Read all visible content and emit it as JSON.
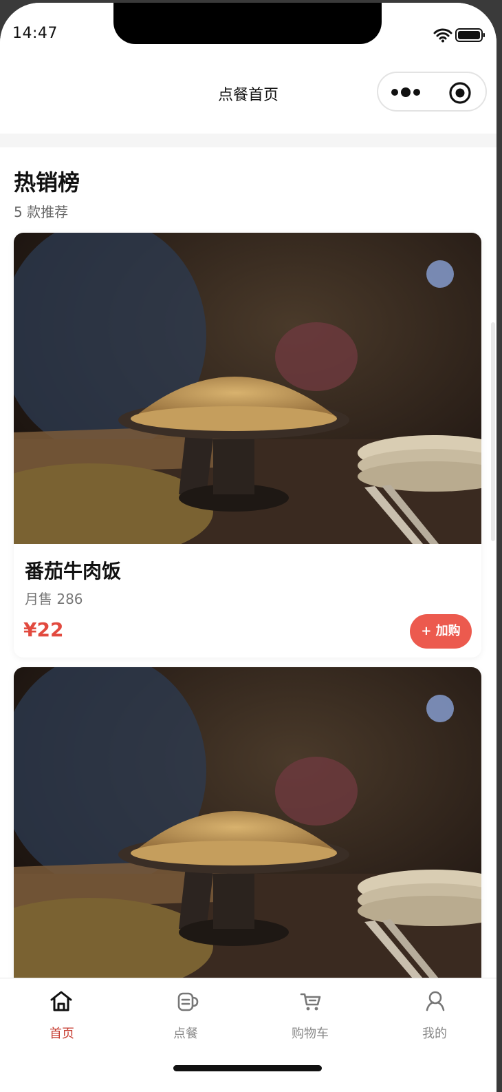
{
  "status_bar": {
    "time": "14:47"
  },
  "nav": {
    "title": "点餐首页"
  },
  "section": {
    "title": "热销榜",
    "subtitle": "5 款推荐"
  },
  "products": [
    {
      "name": "番茄牛肉饭",
      "sales": "月售 286",
      "price": "¥22",
      "add_label": "+ 加购"
    }
  ],
  "tabs": [
    {
      "label": "首页",
      "icon": "home-icon",
      "active": true
    },
    {
      "label": "点餐",
      "icon": "order-icon",
      "active": false
    },
    {
      "label": "购物车",
      "icon": "cart-icon",
      "active": false
    },
    {
      "label": "我的",
      "icon": "user-icon",
      "active": false
    }
  ],
  "colors": {
    "accent": "#c63b2f",
    "price": "#e24a3f",
    "button": "#ec5a4e"
  }
}
